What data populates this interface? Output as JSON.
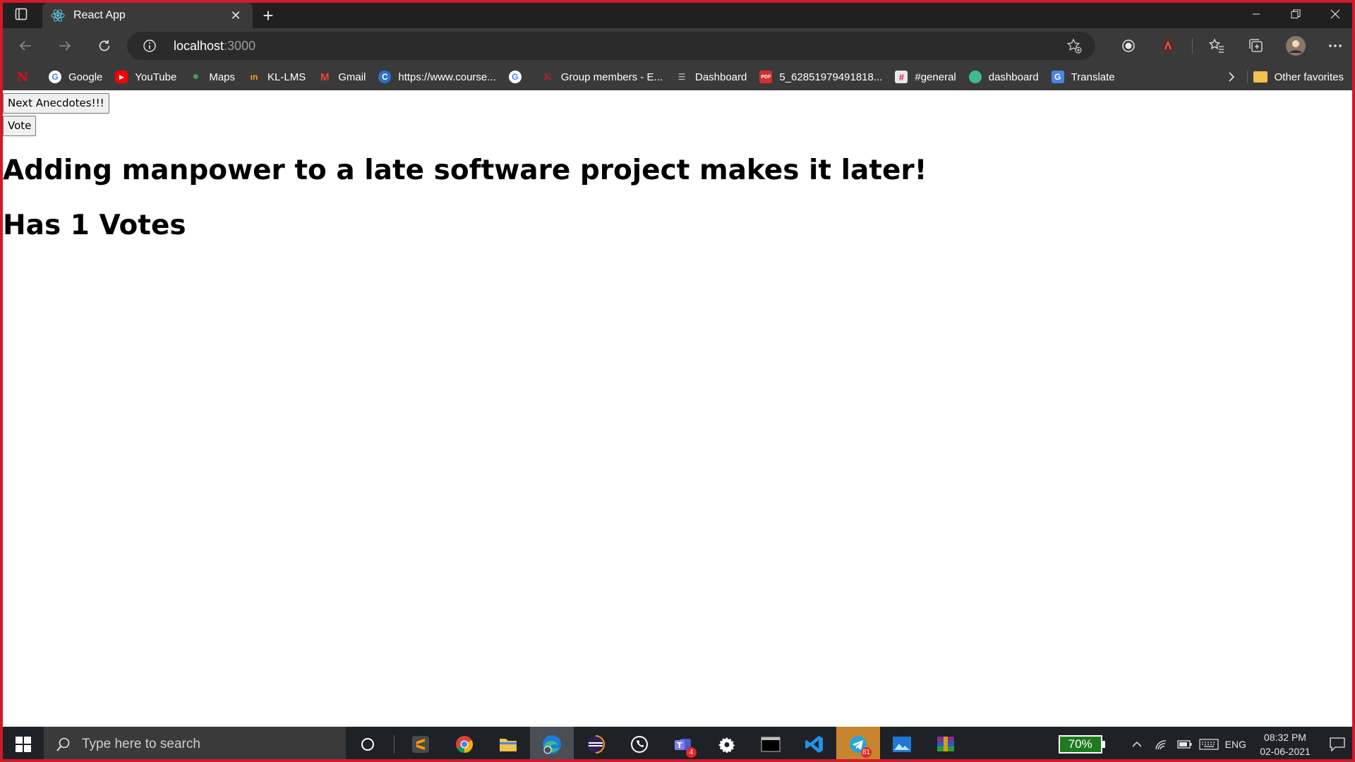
{
  "browser": {
    "tab": {
      "title": "React App"
    },
    "address": {
      "host": "localhost",
      "port": ":3000"
    },
    "favorites": [
      {
        "label": "",
        "icon": "netflix-icon",
        "color": "#e50914"
      },
      {
        "label": "Google",
        "icon": "google-icon",
        "color": "#4285f4"
      },
      {
        "label": "YouTube",
        "icon": "youtube-icon",
        "color": "#ff0000"
      },
      {
        "label": "Maps",
        "icon": "maps-icon",
        "color": "#34a853"
      },
      {
        "label": "KL-LMS",
        "icon": "kl-lms-icon",
        "color": "#f5a623"
      },
      {
        "label": "Gmail",
        "icon": "gmail-icon",
        "color": "#ea4335"
      },
      {
        "label": "https://www.course...",
        "icon": "coursera-icon",
        "color": "#2a73cc"
      },
      {
        "label": "",
        "icon": "google-icon",
        "color": "#4285f4"
      },
      {
        "label": "Group members - E...",
        "icon": "kl-icon",
        "color": "#b21f2d"
      },
      {
        "label": "Dashboard",
        "icon": "dashboard-icon",
        "color": "#8f9bb3"
      },
      {
        "label": "5_62851979491818...",
        "icon": "pdf-icon",
        "color": "#d32f2f"
      },
      {
        "label": "#general",
        "icon": "slack-icon",
        "color": "#e01e5a"
      },
      {
        "label": "dashboard",
        "icon": "edge-icon",
        "color": "#3dbb8f"
      },
      {
        "label": "Translate",
        "icon": "translate-icon",
        "color": "#4a86e8"
      }
    ],
    "other_favorites": "Other favorites"
  },
  "page": {
    "next_button": "Next Anecdotes!!!",
    "vote_button": "Vote",
    "anecdote": "Adding manpower to a late software project makes it later!",
    "votes_text": "Has 1 Votes"
  },
  "taskbar": {
    "search_placeholder": "Type here to search",
    "teams_badge": "4",
    "telegram_badge": "81",
    "battery": "70%",
    "language": "ENG",
    "time": "08:32 PM",
    "date": "02-06-2021"
  },
  "colors": {
    "frame": "#d11a2a",
    "tabstrip": "#202020",
    "toolbar": "#3a3a3a",
    "taskbar": "#1e2227"
  }
}
